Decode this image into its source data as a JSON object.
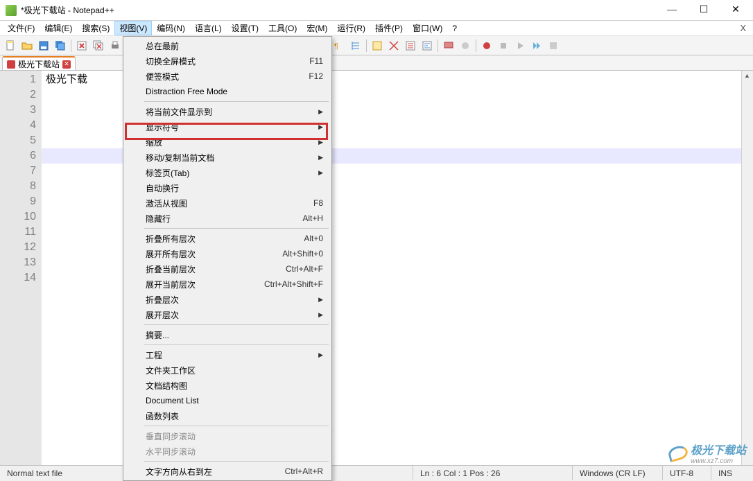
{
  "title": "*极光下载站 - Notepad++",
  "menus": {
    "file": "文件(F)",
    "edit": "编辑(E)",
    "search": "搜索(S)",
    "view": "视图(V)",
    "encoding": "编码(N)",
    "language": "语言(L)",
    "settings": "设置(T)",
    "tools": "工具(O)",
    "macro": "宏(M)",
    "run": "运行(R)",
    "plugins": "插件(P)",
    "window": "窗口(W)",
    "help": "?"
  },
  "tab": {
    "name": "极光下载站"
  },
  "editor": {
    "line1": "极光下载",
    "lines": [
      "1",
      "2",
      "3",
      "4",
      "5",
      "6",
      "7",
      "8",
      "9",
      "10",
      "11",
      "12",
      "13",
      "14"
    ]
  },
  "dropdown": {
    "always_top": "总在最前",
    "fullscreen": "切换全屏模式",
    "fullscreen_k": "F11",
    "postit": "便签模式",
    "postit_k": "F12",
    "distraction": "Distraction Free Mode",
    "move_to": "将当前文件显示到",
    "show_symbol": "显示符号",
    "zoom": "缩放",
    "move_clone": "移动/复制当前文档",
    "tab_page": "标签页(Tab)",
    "wordwrap": "自动换行",
    "focus_view": "激活从视图",
    "focus_view_k": "F8",
    "hide_lines": "隐藏行",
    "hide_lines_k": "Alt+H",
    "fold_all": "折叠所有层次",
    "fold_all_k": "Alt+0",
    "unfold_all": "展开所有层次",
    "unfold_all_k": "Alt+Shift+0",
    "fold_cur": "折叠当前层次",
    "fold_cur_k": "Ctrl+Alt+F",
    "unfold_cur": "展开当前层次",
    "unfold_cur_k": "Ctrl+Alt+Shift+F",
    "fold_level": "折叠层次",
    "unfold_level": "展开层次",
    "summary": "摘要...",
    "project": "工程",
    "folder_ws": "文件夹工作区",
    "doc_map": "文档结构图",
    "doc_list": "Document List",
    "func_list": "函数列表",
    "vsync": "垂直同步滚动",
    "hsync": "水平同步滚动",
    "rtl": "文字方向从右到左",
    "rtl_k": "Ctrl+Alt+R"
  },
  "status": {
    "type": "Normal text file",
    "pos": "Ln : 6    Col : 1    Pos : 26",
    "eol": "Windows (CR LF)",
    "enc": "UTF-8",
    "ins": "INS"
  },
  "watermark": {
    "text": "极光下载站",
    "url": "www.xz7.com"
  }
}
